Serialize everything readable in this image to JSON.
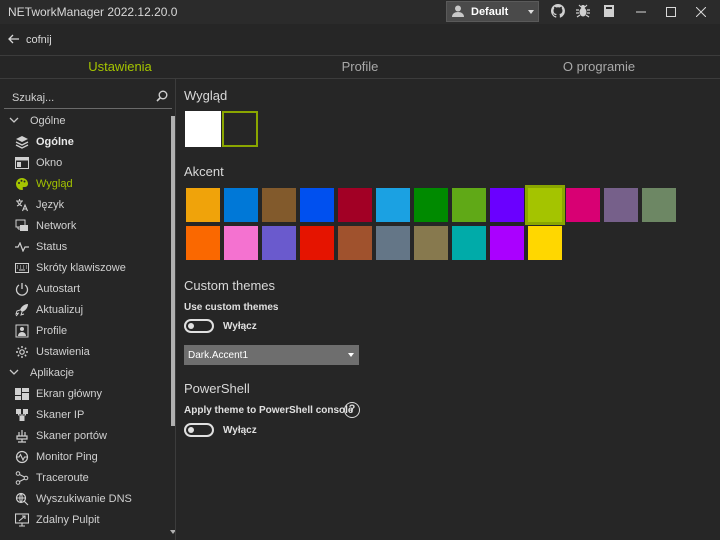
{
  "window": {
    "title": "NETworkManager 2022.12.20.0",
    "profile_value": "Default"
  },
  "header": {
    "back_label": "cofnij"
  },
  "tabs": [
    {
      "label": "Ustawienia",
      "active": true
    },
    {
      "label": "Profile",
      "active": false
    },
    {
      "label": "O programie",
      "active": false
    }
  ],
  "sidebar": {
    "search_placeholder": "Szukaj...",
    "groups": [
      {
        "label": "Ogólne",
        "items": [
          {
            "label": "Ogólne",
            "icon": "layers-icon",
            "state": "bold"
          },
          {
            "label": "Okno",
            "icon": "window-icon",
            "state": ""
          },
          {
            "label": "Wygląd",
            "icon": "palette-icon",
            "state": "active"
          },
          {
            "label": "Język",
            "icon": "translate-icon",
            "state": ""
          },
          {
            "label": "Network",
            "icon": "network-icon",
            "state": ""
          },
          {
            "label": "Status",
            "icon": "pulse-icon",
            "state": ""
          },
          {
            "label": "Skróty klawiszowe",
            "icon": "keyboard-icon",
            "state": ""
          },
          {
            "label": "Autostart",
            "icon": "power-icon",
            "state": ""
          },
          {
            "label": "Aktualizuj",
            "icon": "rocket-icon",
            "state": ""
          },
          {
            "label": "Profile",
            "icon": "profile-icon",
            "state": ""
          },
          {
            "label": "Ustawienia",
            "icon": "gear-icon",
            "state": ""
          }
        ]
      },
      {
        "label": "Aplikacje",
        "items": [
          {
            "label": "Ekran główny",
            "icon": "dashboard-icon",
            "state": ""
          },
          {
            "label": "Skaner IP",
            "icon": "ip-scanner-icon",
            "state": ""
          },
          {
            "label": "Skaner portów",
            "icon": "port-scanner-icon",
            "state": ""
          },
          {
            "label": "Monitor Ping",
            "icon": "ping-monitor-icon",
            "state": ""
          },
          {
            "label": "Traceroute",
            "icon": "traceroute-icon",
            "state": ""
          },
          {
            "label": "Wyszukiwanie DNS",
            "icon": "dns-lookup-icon",
            "state": ""
          },
          {
            "label": "Zdalny Pulpit",
            "icon": "remote-desktop-icon",
            "state": ""
          }
        ]
      }
    ]
  },
  "appearance": {
    "title": "Wygląd",
    "themes": [
      {
        "name": "light",
        "color": "#ffffff",
        "selected": false
      },
      {
        "name": "dark",
        "color": "#262626",
        "selected": true
      }
    ]
  },
  "accent": {
    "title": "Akcent",
    "row1": [
      "#f0a30a",
      "#0078d7",
      "#825a2c",
      "#0050ef",
      "#a20025",
      "#1ba1e2",
      "#008a00",
      "#60a917",
      "#6a00ff",
      "#a4c400",
      "#d80073",
      "#76608a",
      "#6d8764"
    ],
    "row2": [
      "#fa6800",
      "#f472d0",
      "#6a5acd",
      "#e51400",
      "#a0522d",
      "#647687",
      "#87794e",
      "#00aba9",
      "#aa00ff",
      "#ffd700"
    ],
    "selected": "#a4c400"
  },
  "custom_themes": {
    "title": "Custom themes",
    "use_label": "Use custom themes",
    "toggle_label": "Wyłącz",
    "select_value": "Dark.Accent1"
  },
  "powershell": {
    "title": "PowerShell",
    "apply_label": "Apply theme to PowerShell console",
    "toggle_label": "Wyłącz"
  }
}
